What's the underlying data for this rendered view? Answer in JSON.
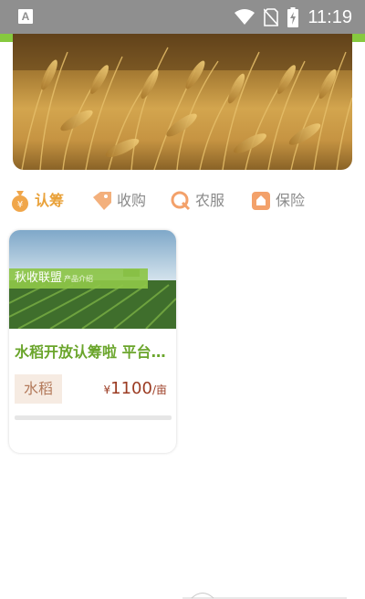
{
  "status_bar": {
    "left_icon_letter": "A",
    "icons": [
      "wifi-icon",
      "no-sim-icon",
      "battery-charging-icon"
    ],
    "time": "11:19"
  },
  "colors": {
    "accent_green": "#86c93f",
    "active_tab": "#e9a23b",
    "inactive_tab": "#8a8a8a",
    "title_green": "#6aa52b",
    "price_red": "#9b3b22",
    "tag_bg": "#f6ebe2"
  },
  "banner": {
    "image": "wheat-field-photo"
  },
  "categories": [
    {
      "label": "认筹",
      "icon": "money-bag-icon",
      "active": true
    },
    {
      "label": "收购",
      "icon": "tag-icon",
      "active": false
    },
    {
      "label": "农服",
      "icon": "service-icon",
      "active": false
    },
    {
      "label": "保险",
      "icon": "insurance-icon",
      "active": false
    }
  ],
  "products": [
    {
      "image": "crop-field-photo",
      "overlay_title": "秋收联盟",
      "overlay_subtitle": "产品介绍",
      "title": "水稻开放认筹啦 平台…",
      "tag": "水稻",
      "price_currency": "¥",
      "price_value": "1100",
      "price_unit": "/亩"
    }
  ]
}
